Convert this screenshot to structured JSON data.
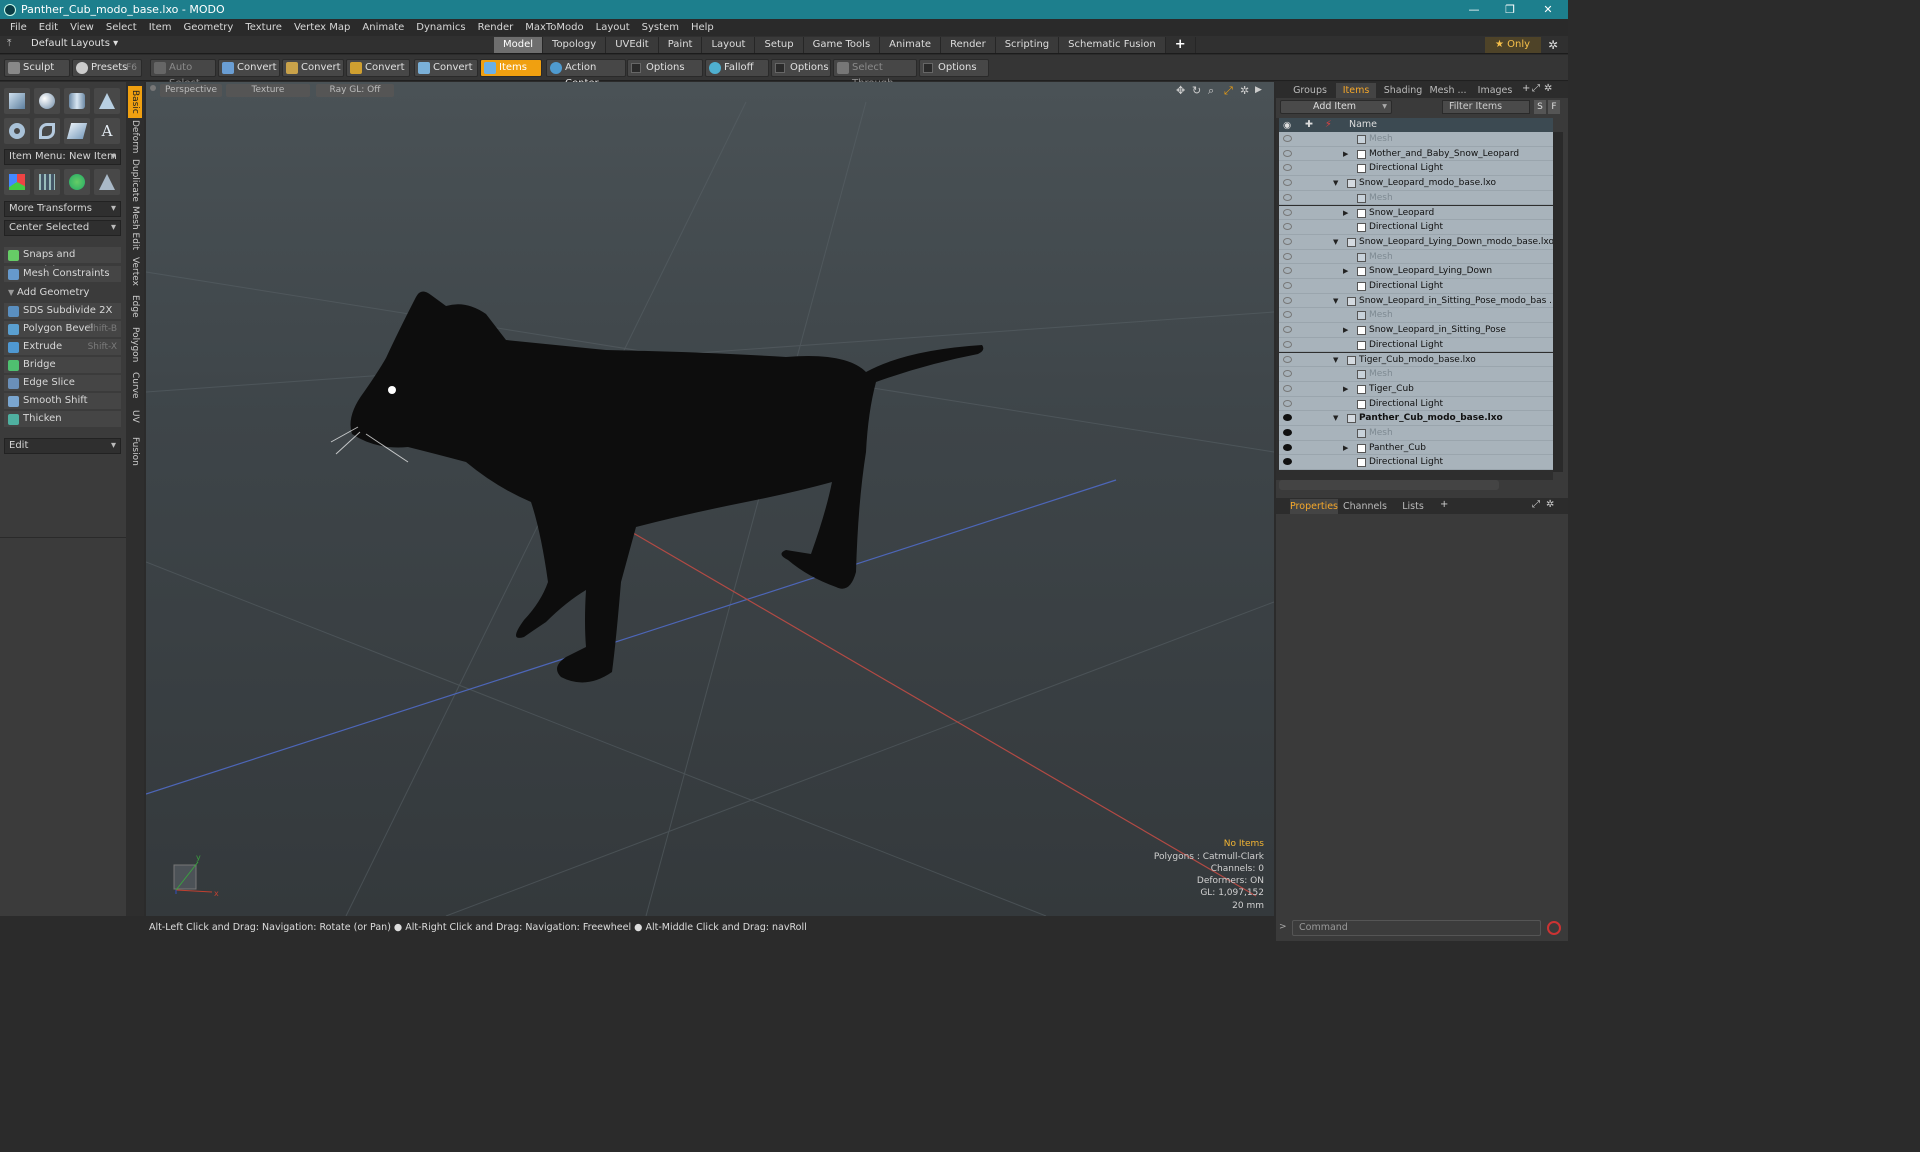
{
  "window": {
    "title": "Panther_Cub_modo_base.lxo - MODO",
    "min": "—",
    "max": "❐",
    "close": "✕"
  },
  "menu": [
    "File",
    "Edit",
    "View",
    "Select",
    "Item",
    "Geometry",
    "Texture",
    "Vertex Map",
    "Animate",
    "Dynamics",
    "Render",
    "MaxToModo",
    "Layout",
    "System",
    "Help"
  ],
  "layout": {
    "label": "Default Layouts ▾",
    "tabs": [
      "Model",
      "Topology",
      "UVEdit",
      "Paint",
      "Layout",
      "Setup",
      "Game Tools",
      "Animate",
      "Render",
      "Scripting",
      "Schematic Fusion"
    ],
    "active": "Model",
    "plus": "+",
    "only": "★  Only"
  },
  "toolbar": {
    "sculpt": "Sculpt",
    "presets": "Presets",
    "presets_key": "F6",
    "auto_select": "Auto Select",
    "convert1": "Convert",
    "convert2": "Convert",
    "convert3": "Convert",
    "convert4": "Convert",
    "items": "Items",
    "action_center": "Action Center",
    "options1": "Options",
    "falloff": "Falloff",
    "options2": "Options",
    "select_through": "Select Through",
    "options3": "Options"
  },
  "left": {
    "item_menu": "Item Menu: New Item",
    "more_transforms": "More Transforms",
    "center_selected": "Center Selected",
    "snaps": "Snaps and Precision",
    "mesh_constraints": "Mesh Constraints",
    "add_geometry": "Add Geometry",
    "tools": [
      {
        "label": "SDS Subdivide 2X",
        "key": ""
      },
      {
        "label": "Polygon Bevel",
        "key": "Shift-B"
      },
      {
        "label": "Extrude",
        "key": "Shift-X"
      },
      {
        "label": "Bridge",
        "key": ""
      },
      {
        "label": "Edge Slice",
        "key": ""
      },
      {
        "label": "Smooth Shift",
        "key": ""
      },
      {
        "label": "Thicken",
        "key": ""
      }
    ],
    "edit": "Edit"
  },
  "vtabs": [
    "Basic",
    "Deform",
    "Duplicate",
    "Mesh Edit",
    "Vertex",
    "Edge",
    "Polygon",
    "Curve",
    "UV",
    "Fusion"
  ],
  "viewport": {
    "view": "Perspective",
    "shading": "Texture",
    "raygl": "Ray GL: Off",
    "stats": {
      "no_items": "No Items",
      "polygons": "Polygons : Catmull-Clark",
      "channels": "Channels: 0",
      "deformers": "Deformers: ON",
      "gl": "GL: 1,097,152",
      "scale": "20 mm"
    }
  },
  "status": "Alt-Left Click and Drag: Navigation: Rotate (or Pan) ● Alt-Right Click and Drag: Navigation: Freewheel ● Alt-Middle Click and Drag: navRoll",
  "right": {
    "tabs": [
      "Groups",
      "Items",
      "Shading",
      "Mesh ...",
      "Images"
    ],
    "active": "Items",
    "add_item": "Add Item",
    "filter": "Filter Items",
    "s": "S",
    "f": "F",
    "name_col": "Name",
    "rows": [
      {
        "label": "Mesh",
        "indent": 2,
        "type": "mesh",
        "dim": true
      },
      {
        "label": "Mother_and_Baby_Snow_Leopard",
        "indent": 2,
        "type": "group",
        "tri": "▶"
      },
      {
        "label": "Directional Light",
        "indent": 2,
        "type": "light"
      },
      {
        "label": "Snow_Leopard_modo_base.lxo",
        "indent": 1,
        "type": "scene",
        "tri": "▼"
      },
      {
        "label": "Mesh",
        "indent": 2,
        "type": "mesh",
        "dim": true
      },
      {
        "label": "Snow_Leopard",
        "indent": 2,
        "type": "group",
        "tri": "▶"
      },
      {
        "label": "Directional Light",
        "indent": 2,
        "type": "light"
      },
      {
        "label": "Snow_Leopard_Lying_Down_modo_base.lxo",
        "indent": 1,
        "type": "scene",
        "tri": "▼"
      },
      {
        "label": "Mesh",
        "indent": 2,
        "type": "mesh",
        "dim": true
      },
      {
        "label": "Snow_Leopard_Lying_Down",
        "indent": 2,
        "type": "group",
        "tri": "▶"
      },
      {
        "label": "Directional Light",
        "indent": 2,
        "type": "light"
      },
      {
        "label": "Snow_Leopard_in_Sitting_Pose_modo_bas ...",
        "indent": 1,
        "type": "scene",
        "tri": "▼"
      },
      {
        "label": "Mesh",
        "indent": 2,
        "type": "mesh",
        "dim": true
      },
      {
        "label": "Snow_Leopard_in_Sitting_Pose",
        "indent": 2,
        "type": "group",
        "tri": "▶"
      },
      {
        "label": "Directional Light",
        "indent": 2,
        "type": "light"
      },
      {
        "label": "Tiger_Cub_modo_base.lxo",
        "indent": 1,
        "type": "scene",
        "tri": "▼"
      },
      {
        "label": "Mesh",
        "indent": 2,
        "type": "mesh",
        "dim": true
      },
      {
        "label": "Tiger_Cub",
        "indent": 2,
        "type": "group",
        "tri": "▶"
      },
      {
        "label": "Directional Light",
        "indent": 2,
        "type": "light"
      },
      {
        "label": "Panther_Cub_modo_base.lxo",
        "indent": 1,
        "type": "scene",
        "tri": "▼",
        "bold": true,
        "visible": true
      },
      {
        "label": "Mesh",
        "indent": 2,
        "type": "mesh",
        "dim": true,
        "visible": true
      },
      {
        "label": "Panther_Cub",
        "indent": 2,
        "type": "group",
        "tri": "▶",
        "visible": true
      },
      {
        "label": "Directional Light",
        "indent": 2,
        "type": "light",
        "visible": true
      }
    ],
    "lower_tabs": [
      "Properties",
      "Channels",
      "Lists"
    ],
    "lower_active": "Properties",
    "command_placeholder": "Command"
  }
}
